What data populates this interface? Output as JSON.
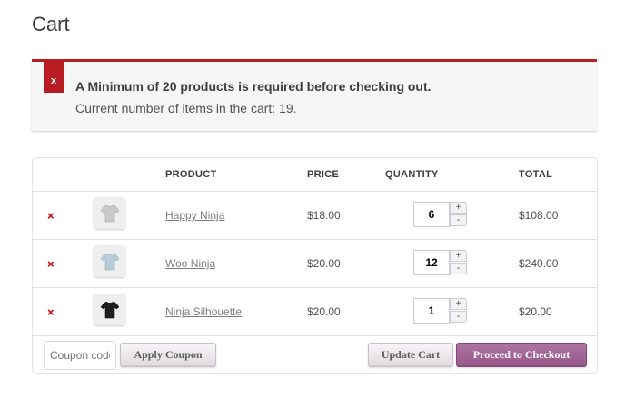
{
  "page": {
    "title": "Cart"
  },
  "notice": {
    "icon": "x",
    "message": "A Minimum of 20 products is required before checking out.",
    "detail": "Current number of items in the cart: 19."
  },
  "table": {
    "headers": {
      "product": "PRODUCT",
      "price": "PRICE",
      "quantity": "QUANTITY",
      "total": "TOTAL"
    },
    "rows": [
      {
        "remove": "×",
        "name": "Happy Ninja",
        "price": "$18.00",
        "qty": "6",
        "total": "$108.00",
        "shirt_color": "#c9c9c9"
      },
      {
        "remove": "×",
        "name": "Woo Ninja",
        "price": "$20.00",
        "qty": "12",
        "total": "$240.00",
        "shirt_color": "#b7cbd9"
      },
      {
        "remove": "×",
        "name": "Ninja Silhouette",
        "price": "$20.00",
        "qty": "1",
        "total": "$20.00",
        "shirt_color": "#1e1e1e"
      }
    ],
    "qty_plus": "+",
    "qty_minus": "-"
  },
  "actions": {
    "coupon_placeholder": "Coupon code",
    "apply_label": "Apply Coupon",
    "update_label": "Update Cart",
    "checkout_label": "Proceed to Checkout"
  },
  "colors": {
    "error": "#b81c23",
    "checkout": "#a46497",
    "remove": "#cc0000"
  }
}
